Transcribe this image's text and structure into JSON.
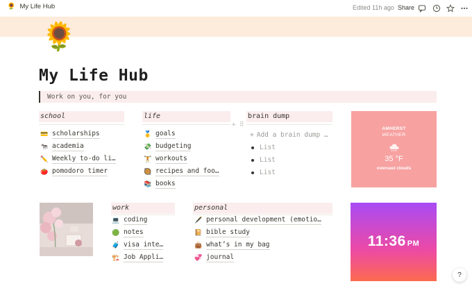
{
  "topbar": {
    "page_icon": "🌻",
    "page_title": "My Life Hub",
    "edited": "Edited 11h ago",
    "share": "Share"
  },
  "page": {
    "icon": "🌻",
    "title": "My Life Hub",
    "quote": "Work on you, for you"
  },
  "school": {
    "heading": "school",
    "items": [
      {
        "emoji": "💳",
        "label": "scholarships"
      },
      {
        "emoji": "🐄",
        "label": "academia"
      },
      {
        "emoji": "✏️",
        "label": "Weekly to-do li…"
      },
      {
        "emoji": "🍅",
        "label": "pomodoro timer"
      }
    ]
  },
  "life": {
    "heading": "life",
    "items": [
      {
        "emoji": "🥇",
        "label": "goals"
      },
      {
        "emoji": "💸",
        "label": "budgeting"
      },
      {
        "emoji": "🏋️",
        "label": "workouts"
      },
      {
        "emoji": "🥘",
        "label": "recipes and foo…"
      },
      {
        "emoji": "📚",
        "label": "books"
      }
    ]
  },
  "brain_dump": {
    "heading": "brain dump",
    "add_text": "Add a brain dump …",
    "items": [
      "List",
      "List",
      "List"
    ]
  },
  "weather": {
    "city": "AMHERST",
    "label": "WEATHER",
    "temp": "35 °F",
    "desc": "overcast clouds"
  },
  "work": {
    "heading": "work",
    "items": [
      {
        "emoji": "💻",
        "label": "coding"
      },
      {
        "emoji": "🟢",
        "label": "notes"
      },
      {
        "emoji": "🧳",
        "label": "visa inte…"
      },
      {
        "emoji": "🏗️",
        "label": "Job Appli…"
      }
    ]
  },
  "personal": {
    "heading": "personal",
    "items": [
      {
        "emoji": "🖋️",
        "label": "personal development (emotio…"
      },
      {
        "emoji": "📔",
        "label": "bible study"
      },
      {
        "emoji": "👜",
        "label": "what’s in my bag"
      },
      {
        "emoji": "💞",
        "label": "journal"
      }
    ]
  },
  "clock": {
    "time": "11:36",
    "ampm": "PM"
  },
  "help": "?"
}
